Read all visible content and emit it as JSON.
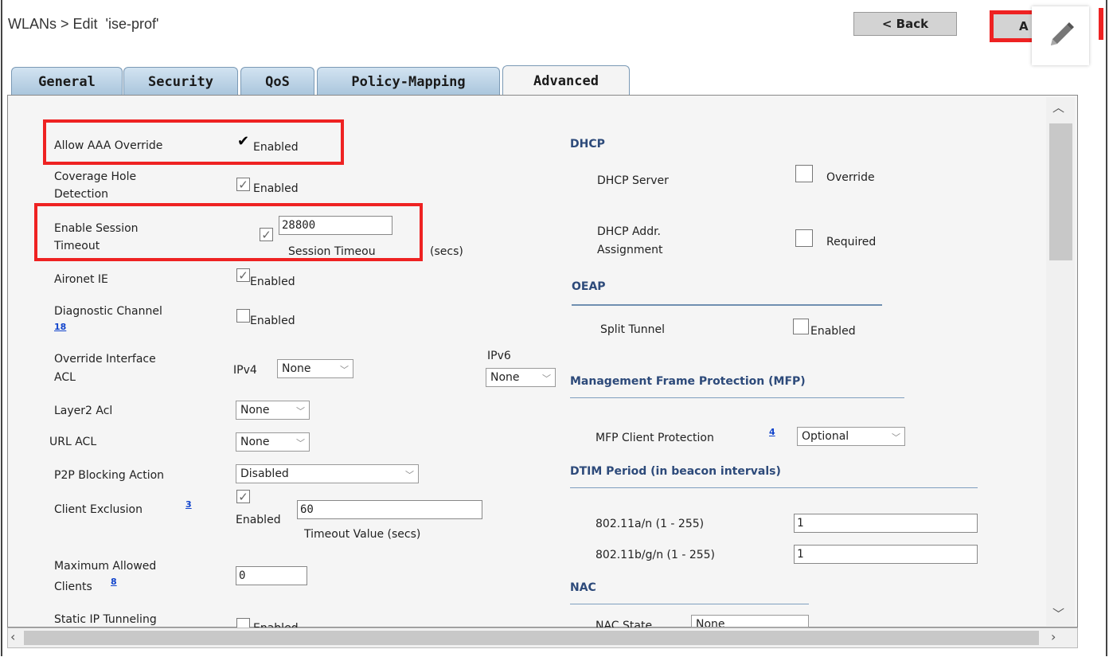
{
  "header": {
    "title": "WLANs > Edit  'ise-prof'",
    "back_label": "< Back",
    "apply_label": "A"
  },
  "tabs": [
    {
      "label": "General"
    },
    {
      "label": "Security"
    },
    {
      "label": "QoS"
    },
    {
      "label": "Policy-Mapping"
    },
    {
      "label": "Advanced"
    }
  ],
  "left": {
    "allow_aaa": {
      "label": "Allow AAA Override",
      "value": "Enabled",
      "checked": true
    },
    "coverage_hole": {
      "label1": "Coverage Hole",
      "label2": "Detection",
      "value": "Enabled",
      "checked": true
    },
    "session_timeout": {
      "label1": "Enable Session",
      "label2": "Timeout",
      "value": "28800",
      "unit": "Session Timeou",
      "unit_suffix": "(secs)",
      "checked": true
    },
    "aironet": {
      "label": "Aironet IE",
      "value": "Enabled",
      "checked": true
    },
    "diag_channel": {
      "label": "Diagnostic Channel",
      "note": "18",
      "value": "Enabled",
      "checked": false
    },
    "override_acl": {
      "label1": "Override Interface",
      "label2": "ACL",
      "ipv4_label": "IPv4",
      "ipv4_value": "None",
      "ipv6_label": "IPv6",
      "ipv6_value": "None"
    },
    "layer2_acl": {
      "label": "Layer2 Acl",
      "value": "None"
    },
    "url_acl": {
      "label": "URL ACL",
      "value": "None"
    },
    "p2p": {
      "label": "P2P Blocking Action",
      "value": "Disabled"
    },
    "client_exclusion": {
      "label": "Client Exclusion",
      "note": "3",
      "enabled_label": "Enabled",
      "value": "60",
      "unit": "Timeout Value (secs)",
      "checked": true
    },
    "max_clients": {
      "label1": "Maximum Allowed",
      "label2": "Clients",
      "note": "8",
      "value": "0"
    },
    "static_ip": {
      "label": "Static IP Tunneling",
      "value": "Enabled"
    }
  },
  "right": {
    "dhcp": {
      "title": "DHCP",
      "server_label": "DHCP Server",
      "server_value": "Override",
      "addr_label1": "DHCP Addr.",
      "addr_label2": "Assignment",
      "addr_value": "Required"
    },
    "oeap": {
      "title": "OEAP",
      "split_label": "Split Tunnel",
      "split_value": "Enabled"
    },
    "mfp": {
      "title": "Management Frame Protection (MFP)",
      "client_label": "MFP Client Protection",
      "note": "4",
      "client_value": "Optional"
    },
    "dtim": {
      "title": "DTIM Period (in beacon intervals)",
      "a_label": "802.11a/n (1 - 255)",
      "a_value": "1",
      "b_label": "802.11b/g/n (1 - 255)",
      "b_value": "1"
    },
    "nac": {
      "title": "NAC",
      "state_label": "NAC State",
      "state_value": "None"
    }
  },
  "colors": {
    "highlight": "#e22222",
    "tab": "#b8d0e4",
    "section": "#2d4a7a"
  }
}
